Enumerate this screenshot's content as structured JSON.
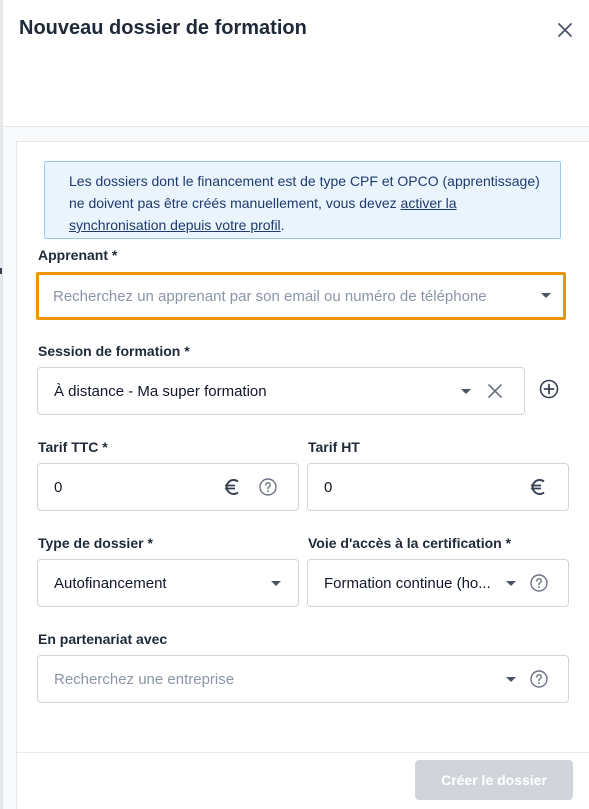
{
  "dialog": {
    "title": "Nouveau dossier de formation"
  },
  "info": {
    "text_before": "Les dossiers dont le financement est de type CPF et OPCO (apprentissage) ne doivent pas être créés manuellement, vous devez ",
    "link": "activer la synchronisation depuis votre profil",
    "text_after": "."
  },
  "apprenant": {
    "label": "Apprenant *",
    "placeholder": "Recherchez un apprenant par son email ou numéro de téléphone"
  },
  "session": {
    "label": "Session de formation *",
    "value": "À distance - Ma super formation"
  },
  "tarif_ttc": {
    "label": "Tarif TTC *",
    "value": "0"
  },
  "tarif_ht": {
    "label": "Tarif HT",
    "value": "0"
  },
  "type_dossier": {
    "label": "Type de dossier *",
    "value": "Autofinancement"
  },
  "voie_acces": {
    "label": "Voie d'accès à la certification *",
    "value": "Formation continue (ho..."
  },
  "partenariat": {
    "label": "En partenariat avec",
    "placeholder": "Recherchez une entreprise"
  },
  "footer": {
    "create_label": "Créer le dossier"
  },
  "colors": {
    "focus_border": "#f39200",
    "info_bg": "#eaf4fd",
    "info_border": "#9cc8ee",
    "button_disabled": "#d1d5db"
  }
}
